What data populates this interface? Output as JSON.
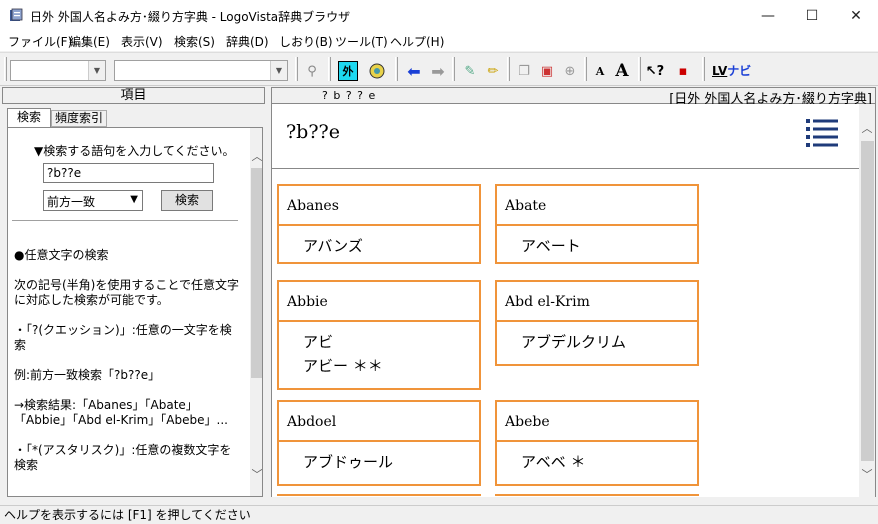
{
  "window": {
    "title": "日外 外国人名よみ方･綴り方字典 - LogoVista辞典ブラウザ",
    "minimize": "—",
    "maximize": "☐",
    "close": "✕"
  },
  "menu": [
    "ファイル(F)",
    "編集(E)",
    "表示(V)",
    "検索(S)",
    "辞典(D)",
    "しおり(B)",
    "ツール(T)",
    "ヘルプ(H)"
  ],
  "toolbar": {
    "gaiji_label": "外",
    "font_small": "A",
    "font_large": "A",
    "navi_label": "ナビ",
    "lv_label": "LV"
  },
  "left": {
    "header": "項目",
    "tab_search": "検索",
    "tab_freq": "頻度索引",
    "prompt": "▼検索する語句を入力してください。",
    "query_value": "?b??e",
    "mode_value": "前方一致",
    "search_button": "検索",
    "help_title": "●任意文字の検索",
    "help_p1": "次の記号(半角)を使用することで任意文字に対応した検索が可能です。",
    "help_p2": "・「?(クエッション)」:任意の一文字を検索",
    "help_p3": "例:前方一致検索「?b??e」",
    "help_p4": "→検索結果:「Abanes」「Abate」「Abbie」「Abd el-Krim」「Abebe」...",
    "help_p5": "・「*(アスタリスク)」:任意の複数文字を検索"
  },
  "right": {
    "header_query": "? b ? ? e",
    "header_dict": "[日外 外国人名よみ方･綴り方字典]",
    "title": "?b??e",
    "cards": [
      {
        "name": "Abanes",
        "readings": [
          "アバンズ"
        ]
      },
      {
        "name": "Abate",
        "readings": [
          "アベート"
        ]
      },
      {
        "name": "Abbie",
        "readings": [
          "アビ",
          "アビー ＊＊"
        ]
      },
      {
        "name": "Abd el-Krim",
        "readings": [
          "アブデルクリム"
        ]
      },
      {
        "name": "Abdoel",
        "readings": [
          "アブドゥール"
        ]
      },
      {
        "name": "Abebe",
        "readings": [
          "アベベ ＊"
        ]
      }
    ]
  },
  "status": "ヘルプを表示するには [F1] を押してください"
}
